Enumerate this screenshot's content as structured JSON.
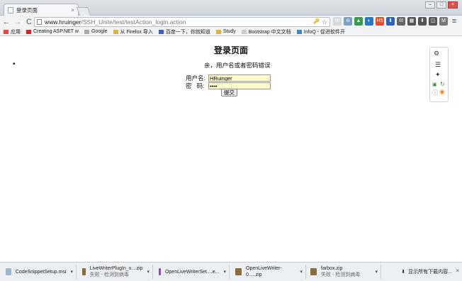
{
  "tab": {
    "title": "登录页面",
    "close": "×"
  },
  "window_controls": {
    "minimize": "–",
    "maximize": "□",
    "close": "×"
  },
  "toolbar": {
    "back": "←",
    "forward": "→",
    "reload": "C",
    "url_host": "www.hruinger",
    "url_path": "/SSH_Unite/test/testAction_login.action",
    "key_icon": "🔑",
    "star_icon": "☆",
    "menu_icon": "≡"
  },
  "extensions": [
    {
      "label": "W",
      "color": "#d8d8d8"
    },
    {
      "label": "⊖",
      "color": "#7aa0c8"
    },
    {
      "label": "▲",
      "color": "#3c9b4a"
    },
    {
      "label": "◐",
      "color": "#2a79c4"
    },
    {
      "label": "H5",
      "color": "#e34c26"
    },
    {
      "label": "⬇",
      "color": "#2b64b8"
    },
    {
      "label": "✉",
      "color": "#666666"
    },
    {
      "label": "▦",
      "color": "#555555"
    },
    {
      "label": "⬇",
      "color": "#555555"
    },
    {
      "label": "◫",
      "color": "#555555"
    },
    {
      "label": "M",
      "color": "#777777"
    }
  ],
  "bookmarks": [
    {
      "label": "应用",
      "color": "#e44"
    },
    {
      "label": "Creating ASP.NET w",
      "color": "#d22"
    },
    {
      "label": "Google",
      "color": "#aaa"
    },
    {
      "label": "从 Firefox 导入",
      "color": "#e0b341"
    },
    {
      "label": "百度一下，你就知道",
      "color": "#3365c8"
    },
    {
      "label": "Study",
      "color": "#e0b341"
    },
    {
      "label": "Bootstrap 中文文档",
      "color": "#ccc"
    },
    {
      "label": "InfoQ - 促进软件开",
      "color": "#3a8cc8"
    }
  ],
  "page": {
    "title": "登录页面",
    "error_message": "亲，用户名或者密码错误",
    "username_label": "用户名:",
    "password_label": "密   码:",
    "username_value": "HRuinger",
    "password_value": "••••",
    "submit_label": "提交"
  },
  "downloads": {
    "items": [
      {
        "name": "CodeSnippetSetup.msi",
        "status": "",
        "color": "#9fb6cc"
      },
      {
        "name": "LiveWriterPlugIn_v....zip",
        "status": "失败 - 检测到病毒",
        "color": "#8a6d3b"
      },
      {
        "name": "OpenLiveWriterSet....e...",
        "status": "",
        "color": "#8a4fb0"
      },
      {
        "name": "OpenLiveWriter-0.....zip",
        "status": "",
        "color": "#8a6d3b"
      },
      {
        "name": "farbox.zip",
        "status": "失败 - 检测到病毒",
        "color": "#8a6d3b"
      }
    ],
    "show_all": "显示所有下载内容...",
    "caret": "▾",
    "close": "×"
  }
}
